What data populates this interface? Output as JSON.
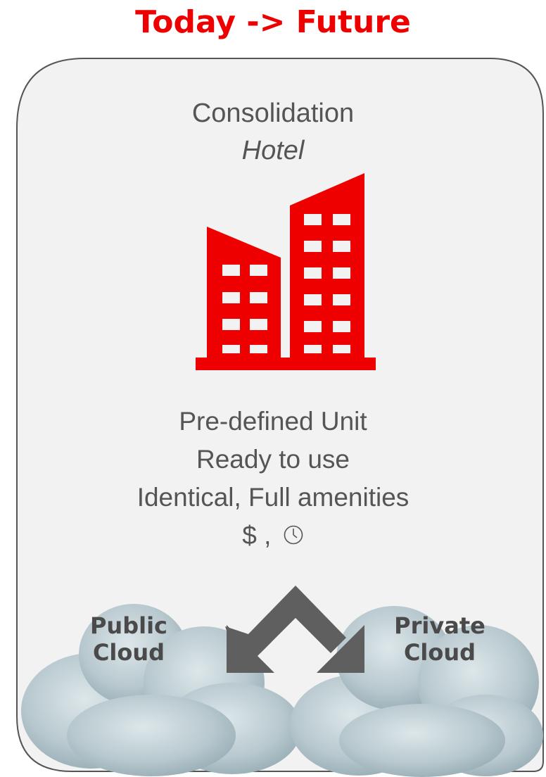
{
  "title": "Today -> Future",
  "heading": {
    "line1": "Consolidation",
    "line2": "Hotel"
  },
  "description": [
    "Pre-defined Unit",
    "Ready to use",
    "Identical, Full amenities"
  ],
  "cost_time": {
    "prefix": "$ ,",
    "icon": "clock-icon"
  },
  "building_icon": "office-building-icon",
  "clouds": {
    "left": {
      "line1": "Public",
      "line2": "Cloud"
    },
    "right": {
      "line1": "Private",
      "line2": "Cloud"
    }
  },
  "colors": {
    "accent": "#ee0000",
    "panel_fill": "#f2f2f2",
    "panel_border": "#555555",
    "text": "#555555",
    "arrow": "#5f5f5f",
    "cloud": "#b4c6cc"
  }
}
